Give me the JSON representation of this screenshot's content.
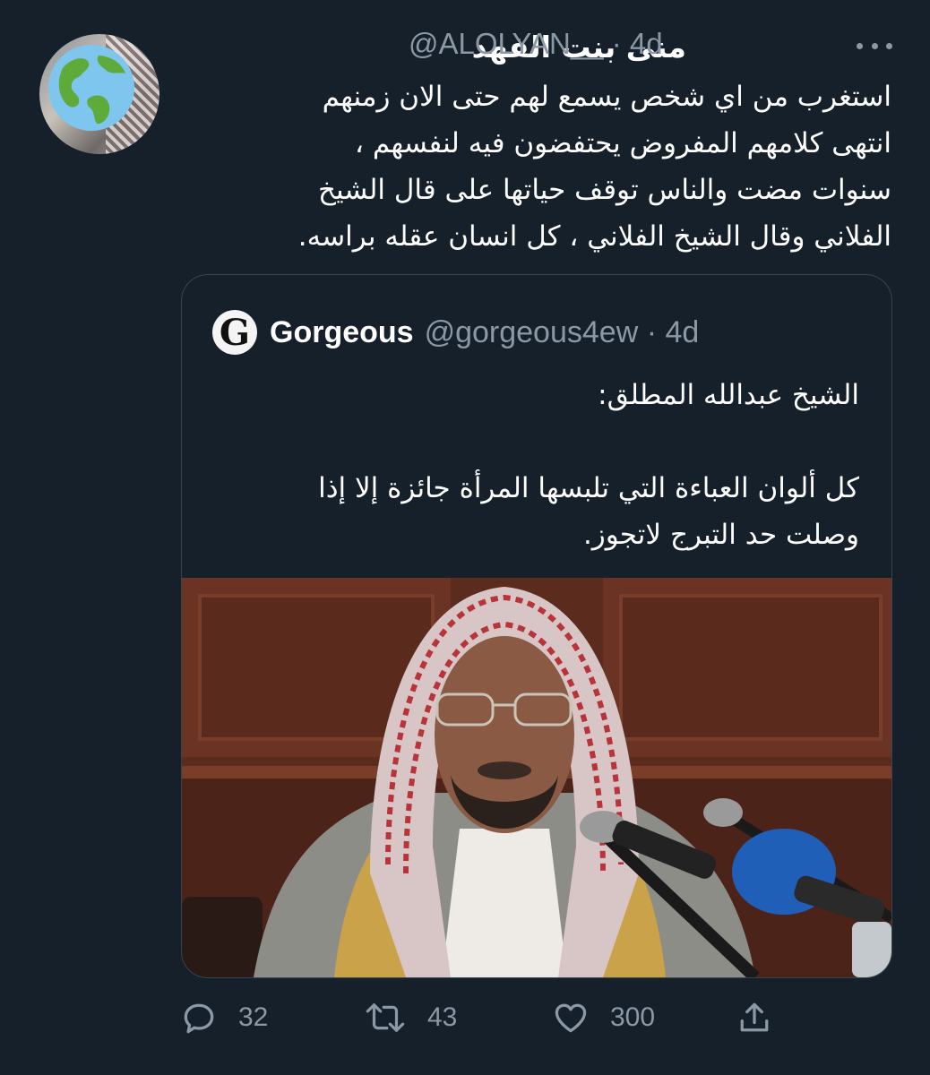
{
  "tweet": {
    "display_name": "منى بنت الفهد",
    "handle": "@ALOLYAN__",
    "age": "4d",
    "text_lines": [
      "استغرب من اي شخص يسمع لهم حتى الان زمنهم",
      "انتهى كلامهم المفروض يحتفضون فيه لنفسهم ،",
      "سنوات مضت والناس توقف حياتها على قال الشيخ",
      "الفلاني وقال الشيخ الفلاني ، كل انسان عقله براسه."
    ]
  },
  "quoted": {
    "avatar_letter": "G",
    "display_name": "Gorgeous",
    "handle": "@gorgeous4ew",
    "age": "4d",
    "text_lines": [
      "الشيخ عبدالله المطلق:",
      "",
      "كل ألوان العباءة التي تلبسها المرأة جائزة إلا إذا",
      "وصلت حد التبرج لاتجوز."
    ]
  },
  "actions": {
    "reply_count": "32",
    "retweet_count": "43",
    "like_count": "300"
  },
  "colors": {
    "background": "#15202b",
    "secondary_text": "#8b98a5",
    "border": "#38444d"
  },
  "icons": [
    "globe-icon",
    "more-icon",
    "reply-icon",
    "retweet-icon",
    "like-icon",
    "share-icon"
  ]
}
